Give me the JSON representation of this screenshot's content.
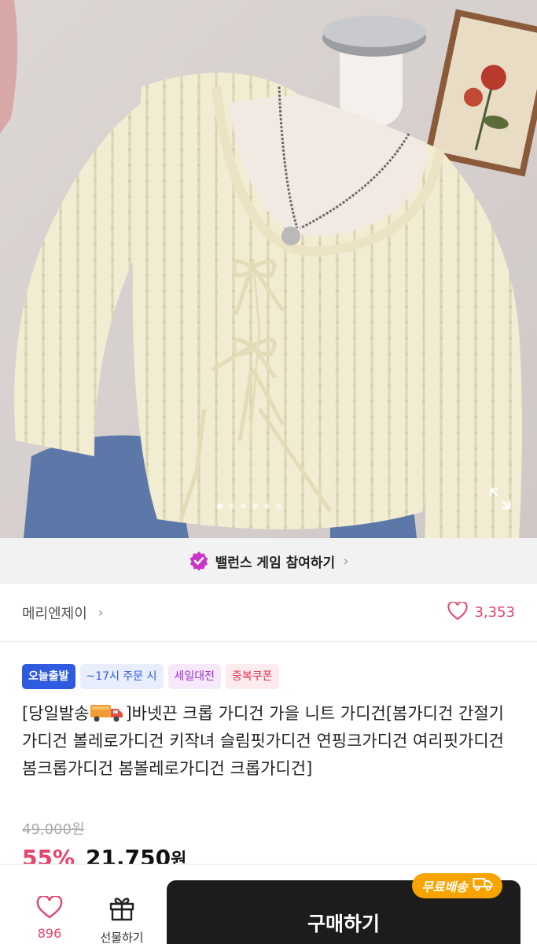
{
  "hero": {
    "slide_count": 6,
    "active_slide": 1
  },
  "banner": {
    "label": "밸런스 게임 참여하기",
    "chevron": "›"
  },
  "seller": {
    "name": "메리엔제이",
    "chevron": "›",
    "like_count": "3,353"
  },
  "tags": [
    "오늘출발",
    "~17시 주문 시",
    "세일대전",
    "중복쿠폰"
  ],
  "product": {
    "title_before": "[당일발송",
    "title_after": "]바넷끈 크롭 가디건 가을 니트 가디건[봄가디건 간절기가디건 볼레로가디건 키작녀 슬림핏가디건 연핑크가디건 여리핏가디건 봄크롭가디건 봄볼레로가디건 크롭가디건]",
    "original_price": "49,000원",
    "discount_rate": "55%",
    "sale_price": "21,750",
    "currency": "원"
  },
  "bottom_bar": {
    "like_count": "896",
    "gift_label": "선물하기",
    "buy_label": "구매하기",
    "shipping_badge": "무료배송"
  },
  "colors": {
    "accent_pink": "#e8436b",
    "buy_button": "#1c1c1c",
    "shipping_badge": "#f7a400",
    "tag_blue": "#2f5be0"
  },
  "icons": [
    "expand-icon",
    "verified-badge-icon",
    "heart-icon",
    "gift-icon",
    "truck-icon"
  ]
}
